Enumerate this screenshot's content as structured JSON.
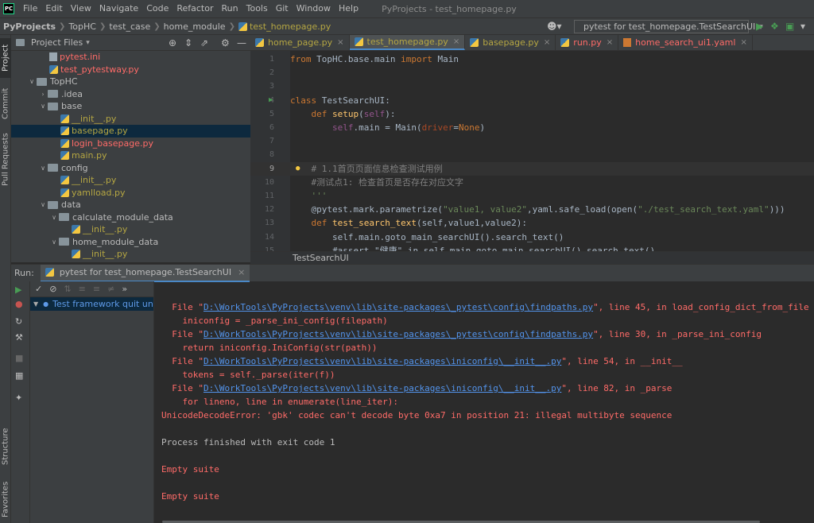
{
  "window": {
    "title": "PyProjects - test_homepage.py",
    "logo": "PC"
  },
  "menu": [
    "File",
    "Edit",
    "View",
    "Navigate",
    "Code",
    "Refactor",
    "Run",
    "Tools",
    "Git",
    "Window",
    "Help"
  ],
  "breadcrumbs": [
    "PyProjects",
    "TopHC",
    "test_case",
    "home_module",
    "test_homepage.py"
  ],
  "run_config": "pytest for test_homepage.TestSearchUI",
  "side_tabs": {
    "project": "Project",
    "commit": "Commit",
    "pull_requests": "Pull Requests",
    "structure": "Structure",
    "favorites": "Favorites"
  },
  "project_panel": {
    "title": "Project Files"
  },
  "tree": [
    {
      "label": "pytest.ini",
      "kind": "ini",
      "indent": 3,
      "color": "#ff6b68"
    },
    {
      "label": "test_pytestway.py",
      "kind": "py",
      "indent": 3,
      "color": "#ff6b68"
    },
    {
      "label": "TopHC",
      "kind": "folder",
      "indent": 1,
      "expanded": true,
      "color": "#bbbbbb"
    },
    {
      "label": ".idea",
      "kind": "folder",
      "indent": 2,
      "expanded": false,
      "color": "#bbbbbb"
    },
    {
      "label": "base",
      "kind": "folder",
      "indent": 2,
      "expanded": true,
      "color": "#bbbbbb"
    },
    {
      "label": "__init__.py",
      "kind": "py",
      "indent": 4,
      "color": "#b5a642"
    },
    {
      "label": "basepage.py",
      "kind": "py",
      "indent": 4,
      "color": "#b5a642",
      "selected": true
    },
    {
      "label": "login_basepage.py",
      "kind": "py",
      "indent": 4,
      "color": "#ff6b68"
    },
    {
      "label": "main.py",
      "kind": "py",
      "indent": 4,
      "color": "#b5a642"
    },
    {
      "label": "config",
      "kind": "folder",
      "indent": 2,
      "expanded": true,
      "color": "#bbbbbb"
    },
    {
      "label": "__init__.py",
      "kind": "py",
      "indent": 4,
      "color": "#b5a642"
    },
    {
      "label": "yamlload.py",
      "kind": "py",
      "indent": 4,
      "color": "#b5a642"
    },
    {
      "label": "data",
      "kind": "folder",
      "indent": 2,
      "expanded": true,
      "color": "#bbbbbb"
    },
    {
      "label": "calculate_module_data",
      "kind": "folder",
      "indent": 3,
      "expanded": true,
      "color": "#bbbbbb"
    },
    {
      "label": "__init__.py",
      "kind": "py",
      "indent": 5,
      "color": "#b5a642"
    },
    {
      "label": "home_module_data",
      "kind": "folder",
      "indent": 3,
      "expanded": true,
      "color": "#bbbbbb"
    },
    {
      "label": "__init__.py",
      "kind": "py",
      "indent": 5,
      "color": "#b5a642"
    }
  ],
  "tabs": [
    {
      "label": "home_page.py",
      "kind": "py",
      "active": false,
      "color": "#b5a642"
    },
    {
      "label": "test_homepage.py",
      "kind": "py",
      "active": true,
      "color": "#b5a642"
    },
    {
      "label": "basepage.py",
      "kind": "py",
      "active": false,
      "color": "#b5a642"
    },
    {
      "label": "run.py",
      "kind": "py",
      "active": false,
      "color": "#ff6b68"
    },
    {
      "label": "home_search_ui1.yaml",
      "kind": "yml",
      "active": false,
      "color": "#ff6b68"
    }
  ],
  "editor": {
    "current_line": 9,
    "lines": [
      {
        "n": "1",
        "html": "<span class='kw'>from</span> TopHC.base.main <span class='kw'>import</span> Main"
      },
      {
        "n": "2",
        "html": ""
      },
      {
        "n": "3",
        "html": ""
      },
      {
        "n": "4",
        "html": "<span class='kw'>class</span> TestSearchUI:",
        "run": true
      },
      {
        "n": "5",
        "html": "    <span class='kw'>def</span> <span class='fn'>setup</span>(<span class='sf'>self</span>):"
      },
      {
        "n": "6",
        "html": "        <span class='sf'>self</span>.main = Main(<span class='prm'>driver</span>=<span class='kw'>None</span>)"
      },
      {
        "n": "7",
        "html": ""
      },
      {
        "n": "8",
        "html": ""
      },
      {
        "n": "9",
        "html": "    <span class='cm'># 1.1首页页面信息检查测试用例</span>",
        "bulb": true
      },
      {
        "n": "10",
        "html": "    <span class='cm'>#测试点1: 检查首页是否存在对应文字</span>"
      },
      {
        "n": "11",
        "html": "    <span class='str'>'''</span>"
      },
      {
        "n": "12",
        "html": "    @pytest.mark.parametrize(<span class='str'>\"value1, value2\"</span>,yaml.safe_load(open(<span class='str'>\"./test_search_text.yaml\"</span>)))"
      },
      {
        "n": "13",
        "html": "    <span class='kw'>def</span> <span class='fn'>test_search_text</span>(self,value1,value2):"
      },
      {
        "n": "14",
        "html": "        self.main.goto_main_searchUI().search_text()"
      },
      {
        "n": "15",
        "html": "        #assert \"健康\" in self.main.goto_main_searchUI().search_text()"
      }
    ]
  },
  "editor_breadcrumb": "TestSearchUI",
  "run_panel": {
    "label": "Run:",
    "tab": "pytest for test_homepage.TestSearchUI",
    "test_item": "Test framework quit unexpectedly"
  },
  "console": [
    {
      "parts": [
        {
          "t": "  File \"",
          "c": "err"
        },
        {
          "t": "D:\\WorkTools\\PyProjects\\venv\\lib\\site-packages\\_pytest\\config\\findpaths.py",
          "c": "lnk"
        },
        {
          "t": "\", line 45, in load_config_dict_from_file",
          "c": "err"
        }
      ]
    },
    {
      "parts": [
        {
          "t": "    iniconfig = _parse_ini_config(filepath)",
          "c": "err"
        }
      ]
    },
    {
      "parts": [
        {
          "t": "  File \"",
          "c": "err"
        },
        {
          "t": "D:\\WorkTools\\PyProjects\\venv\\lib\\site-packages\\_pytest\\config\\findpaths.py",
          "c": "lnk"
        },
        {
          "t": "\", line 30, in _parse_ini_config",
          "c": "err"
        }
      ]
    },
    {
      "parts": [
        {
          "t": "    return iniconfig.IniConfig(str(path))",
          "c": "err"
        }
      ]
    },
    {
      "parts": [
        {
          "t": "  File \"",
          "c": "err"
        },
        {
          "t": "D:\\WorkTools\\PyProjects\\venv\\lib\\site-packages\\iniconfig\\__init__.py",
          "c": "lnk"
        },
        {
          "t": "\", line 54, in __init__",
          "c": "err"
        }
      ]
    },
    {
      "parts": [
        {
          "t": "    tokens = self._parse(iter(f))",
          "c": "err"
        }
      ]
    },
    {
      "parts": [
        {
          "t": "  File \"",
          "c": "err"
        },
        {
          "t": "D:\\WorkTools\\PyProjects\\venv\\lib\\site-packages\\iniconfig\\__init__.py",
          "c": "lnk"
        },
        {
          "t": "\", line 82, in _parse",
          "c": "err"
        }
      ]
    },
    {
      "parts": [
        {
          "t": "    for lineno, line in enumerate(line_iter):",
          "c": "err"
        }
      ]
    },
    {
      "parts": [
        {
          "t": "UnicodeDecodeError: 'gbk' codec can't decode byte 0xa7 in position 21: illegal multibyte sequence",
          "c": "err"
        }
      ]
    },
    {
      "parts": [
        {
          "t": "",
          "c": "plain"
        }
      ]
    },
    {
      "parts": [
        {
          "t": "Process finished with exit code 1",
          "c": "plain"
        }
      ]
    },
    {
      "parts": [
        {
          "t": "",
          "c": "plain"
        }
      ]
    },
    {
      "parts": [
        {
          "t": "Empty suite",
          "c": "err"
        }
      ]
    },
    {
      "parts": [
        {
          "t": "",
          "c": "plain"
        }
      ]
    },
    {
      "parts": [
        {
          "t": "Empty suite",
          "c": "err"
        }
      ]
    }
  ]
}
